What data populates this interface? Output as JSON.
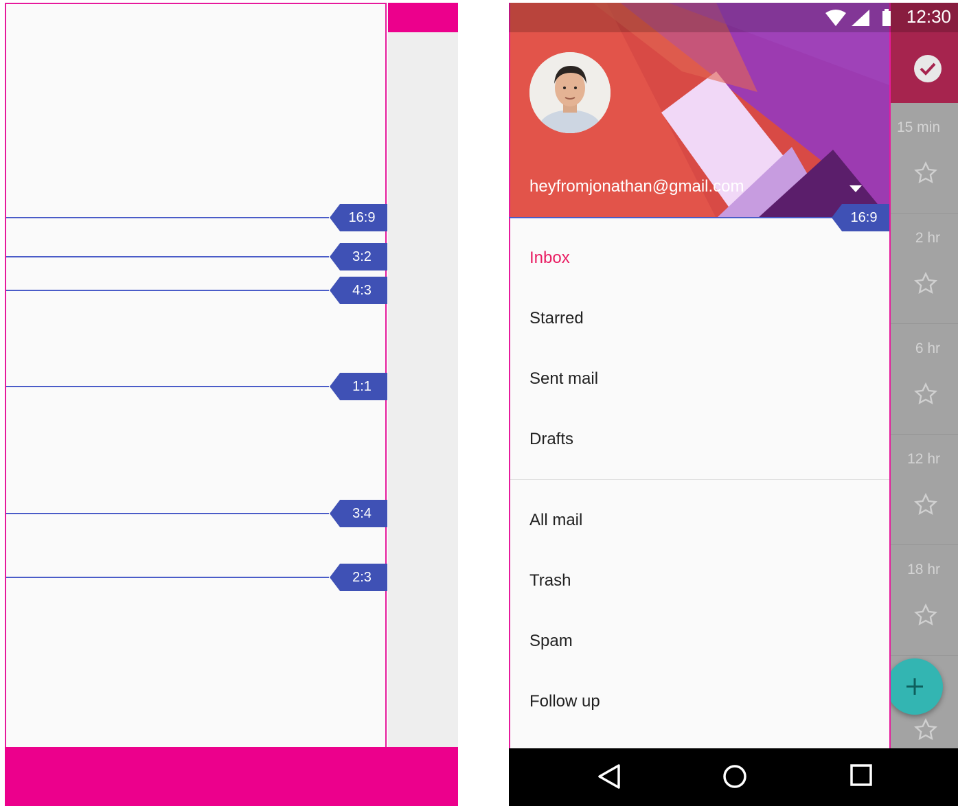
{
  "diagram": {
    "ratios": [
      {
        "label": "16:9"
      },
      {
        "label": "3:2"
      },
      {
        "label": "4:3"
      },
      {
        "label": "1:1"
      },
      {
        "label": "3:4"
      },
      {
        "label": "2:3"
      }
    ],
    "header_ratio": "16:9",
    "colors": {
      "guide": "#e61a9c",
      "tag": "#3f51b5",
      "pink": "#ec008c"
    }
  },
  "status_bar": {
    "time": "12:30",
    "icons": [
      "wifi-icon",
      "signal-icon",
      "battery-icon"
    ]
  },
  "drawer": {
    "account_email": "heyfromjonathan@gmail.com",
    "primary_items": [
      {
        "label": "Inbox",
        "active": true
      },
      {
        "label": "Starred"
      },
      {
        "label": "Sent mail"
      },
      {
        "label": "Drafts"
      }
    ],
    "secondary_items": [
      {
        "label": "All mail"
      },
      {
        "label": "Trash"
      },
      {
        "label": "Spam"
      },
      {
        "label": "Follow up"
      }
    ],
    "accent": "#e91e63"
  },
  "mail_list": {
    "times": [
      "15 min",
      "2 hr",
      "6 hr",
      "12 hr",
      "18 hr"
    ]
  },
  "fab": {
    "icon": "plus-icon",
    "color": "#33b5b2"
  },
  "nav_bar": {
    "icons": [
      "back-icon",
      "home-icon",
      "recents-icon"
    ]
  }
}
